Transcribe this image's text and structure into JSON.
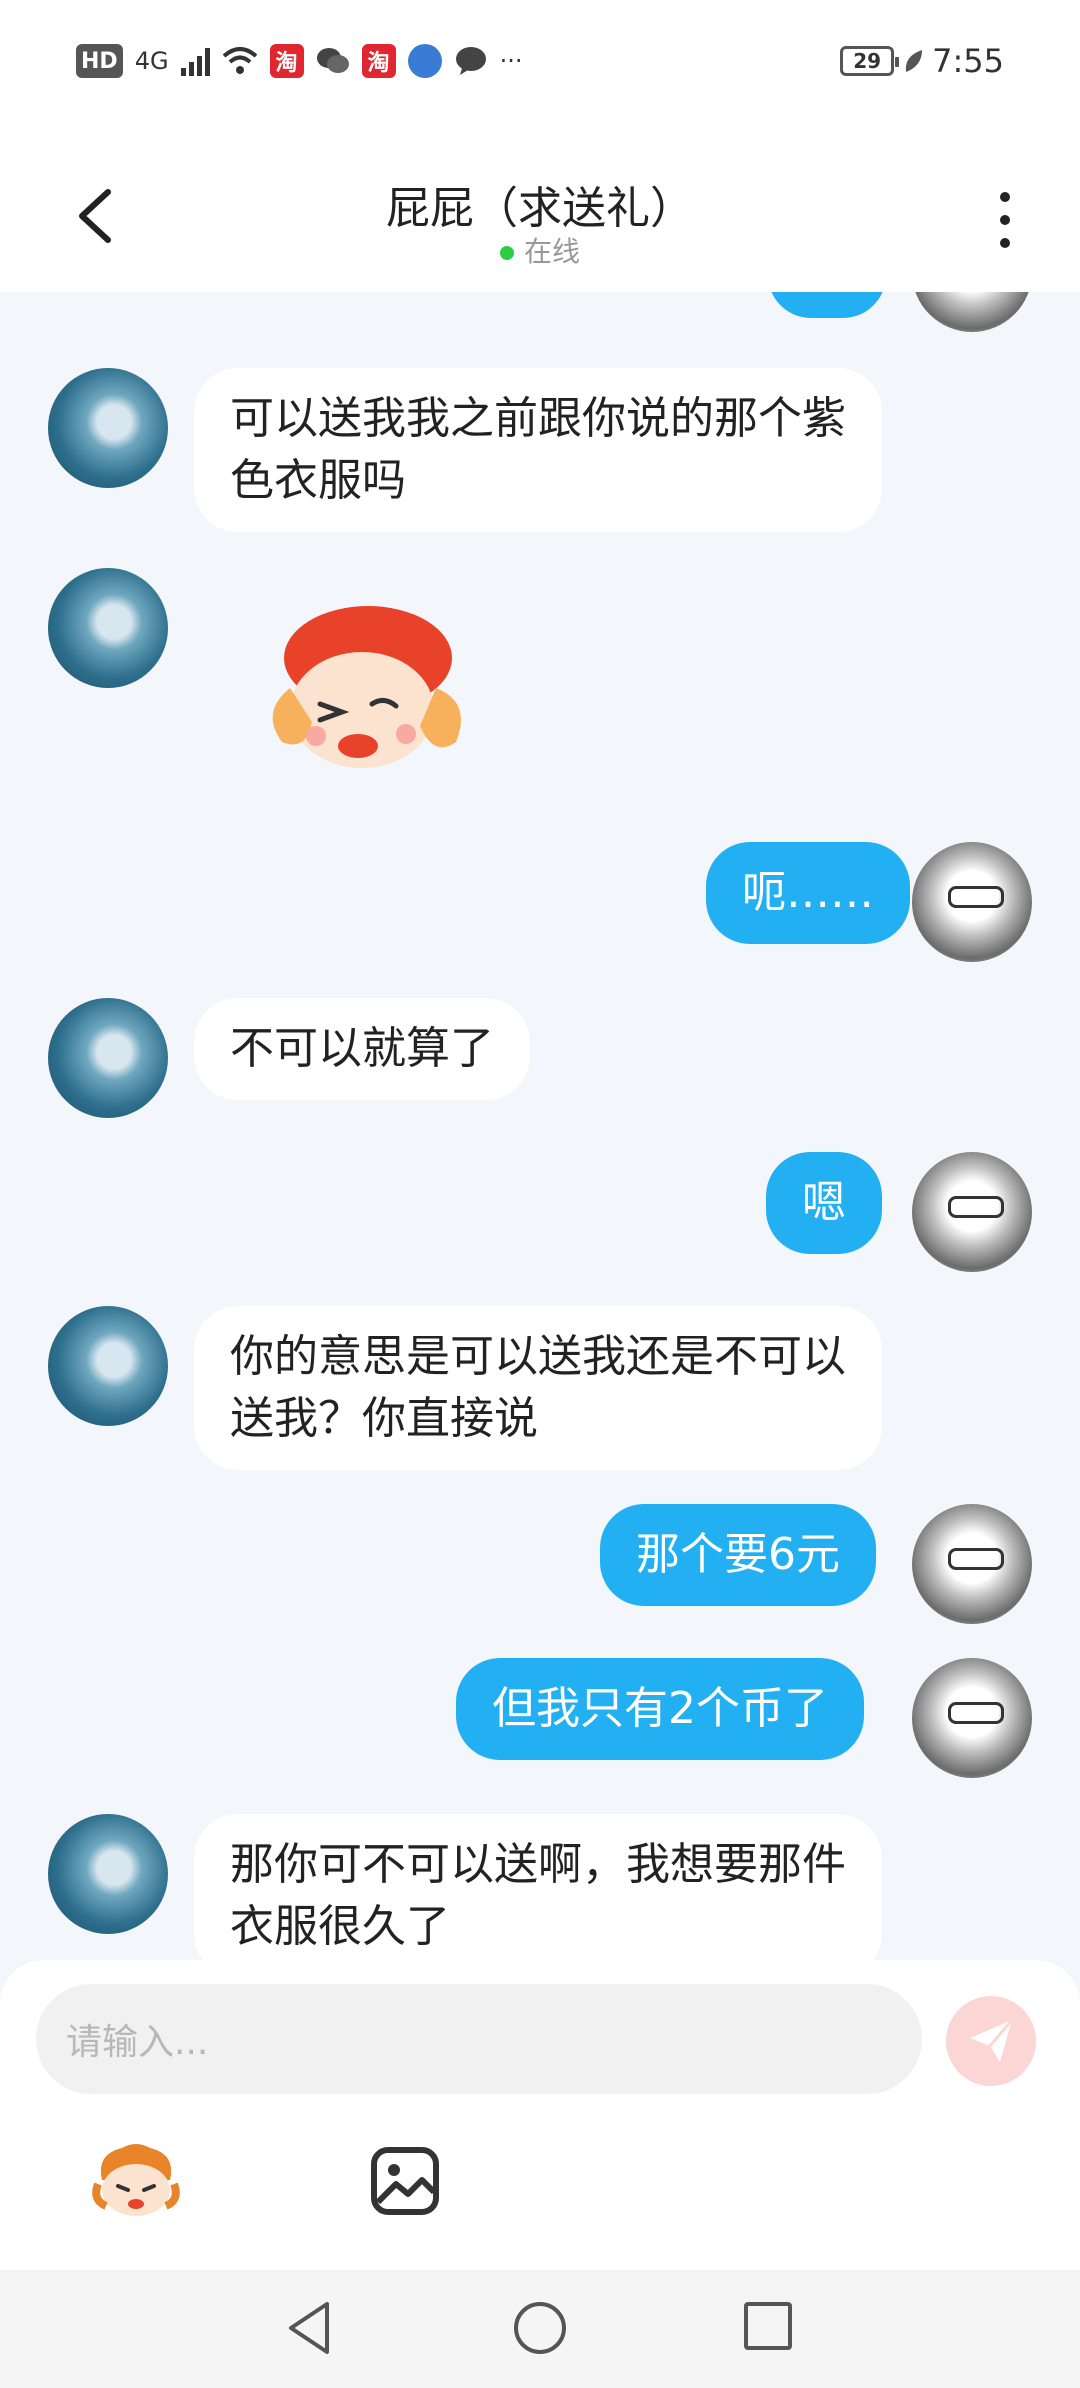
{
  "status_bar": {
    "hd": "HD",
    "signal": "4G",
    "time": "7:55",
    "battery": "29",
    "notification_icons": [
      "taobao-red-icon",
      "wechat-icon",
      "taobao-icon",
      "browser-icon",
      "chat-icon"
    ],
    "more": "···"
  },
  "header": {
    "title": "屁屁（求送礼）",
    "status": "在线",
    "online_color": "#2ecc40"
  },
  "messages": [
    {
      "side": "in",
      "text": "可以送我我之前跟你说的那个紫色衣服吗"
    },
    {
      "side": "in",
      "type": "sticker",
      "sticker": "cartoon-character-sticker"
    },
    {
      "side": "out",
      "text": "呃……"
    },
    {
      "side": "in",
      "text": "不可以就算了"
    },
    {
      "side": "out",
      "text": "嗯"
    },
    {
      "side": "in",
      "text": "你的意思是可以送我还是不可以送我？你直接说"
    },
    {
      "side": "out",
      "text": "那个要6元"
    },
    {
      "side": "out",
      "text": "但我只有2个币了"
    },
    {
      "side": "in",
      "text": "那你可不可以送啊，我想要那件衣服很久了"
    }
  ],
  "composer": {
    "placeholder": "请输入...",
    "send_color": "#fbd6d4"
  },
  "colors": {
    "outgoing_bubble": "#23b0f3",
    "incoming_bubble": "#ffffff",
    "chat_background": "#f3f6fa"
  }
}
